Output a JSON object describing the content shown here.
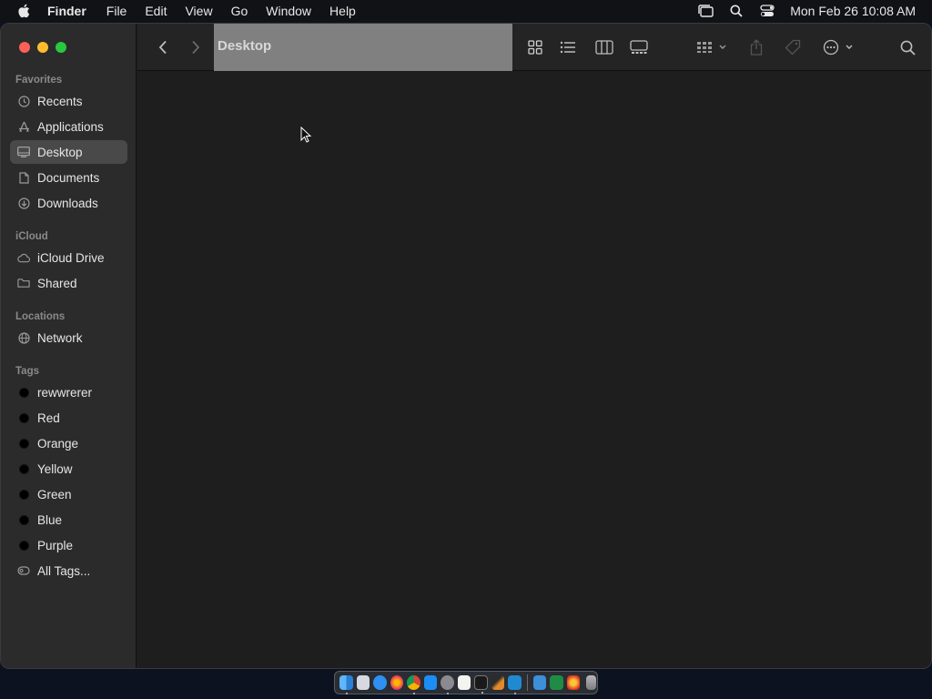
{
  "menubar": {
    "app_name": "Finder",
    "items": [
      "File",
      "Edit",
      "View",
      "Go",
      "Window",
      "Help"
    ],
    "clock": "Mon Feb 26  10:08 AM",
    "status_icons": [
      "stage-manager-icon",
      "spotlight-icon",
      "control-center-icon"
    ]
  },
  "window": {
    "title": "Desktop",
    "traffic_lights": {
      "close": "#fe5f57",
      "minimize": "#febc2e",
      "zoom": "#28c840"
    }
  },
  "sidebar": {
    "favorites_header": "Favorites",
    "favorites": [
      {
        "label": "Recents",
        "icon": "clock-icon"
      },
      {
        "label": "Applications",
        "icon": "applications-icon"
      },
      {
        "label": "Desktop",
        "icon": "desktop-icon",
        "selected": true
      },
      {
        "label": "Documents",
        "icon": "document-icon"
      },
      {
        "label": "Downloads",
        "icon": "download-icon"
      }
    ],
    "icloud_header": "iCloud",
    "icloud": [
      {
        "label": "iCloud Drive",
        "icon": "cloud-icon"
      },
      {
        "label": "Shared",
        "icon": "shared-folder-icon"
      }
    ],
    "locations_header": "Locations",
    "locations": [
      {
        "label": "Network",
        "icon": "network-icon"
      }
    ],
    "tags_header": "Tags",
    "tags": [
      "rewwrerer",
      "Red",
      "Orange",
      "Yellow",
      "Green",
      "Blue",
      "Purple"
    ],
    "all_tags": "All Tags..."
  },
  "toolbar": {
    "icons": [
      "back-icon",
      "forward-icon",
      "icon-view-icon",
      "list-view-icon",
      "column-view-icon",
      "gallery-view-icon",
      "group-icon",
      "share-icon",
      "tag-icon",
      "more-actions-icon",
      "search-icon"
    ]
  },
  "dock": {
    "apps": [
      "finder",
      "launchpad",
      "safari",
      "firefox",
      "chrome",
      "app-store",
      "settings",
      "notes",
      "terminal",
      "brush",
      "vscode",
      "finder-window",
      "excel",
      "photo-booth",
      "trash"
    ],
    "accent": "#2a2d33"
  }
}
